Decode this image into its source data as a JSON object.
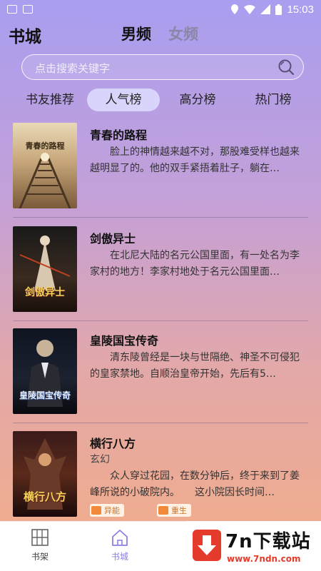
{
  "status_bar": {
    "time": "15:03"
  },
  "header": {
    "title": "书城",
    "tab_male": "男频",
    "tab_female": "女频"
  },
  "search": {
    "placeholder": "点击搜索关键字"
  },
  "rank_tabs": [
    "书友推荐",
    "人气榜",
    "高分榜",
    "热门榜"
  ],
  "books": [
    {
      "title": "青春的路程",
      "description": "脸上的神情越来越不对，那股难受样也越来越明显了的。他的双手紧捂着肚子，躺在…",
      "cover_text": "青春的路程"
    },
    {
      "title": "剑傲异士",
      "description": "在北尼大陆的名元公国里面，有一处名为李家村的地方！李家村地处于名元公国里面…",
      "cover_text": "剑傲异士"
    },
    {
      "title": "皇陵国宝传奇",
      "description": "清东陵曾经是一块与世隔绝、神圣不可侵犯的皇家禁地。自顺治皇帝开始，先后有5…",
      "cover_text": "皇陵国宝传奇"
    },
    {
      "title": "横行八方",
      "genre": "玄幻",
      "description": "众人穿过花园，在数分钟后，终于来到了姜峰所说的小破院内。　　这小院因长时间…",
      "cover_text": "横行八方",
      "tags": [
        "异能",
        "重生"
      ]
    }
  ],
  "bottom_nav": {
    "shelf_label": "书架",
    "store_label": "书城"
  },
  "watermark": {
    "title": "7n下载站",
    "url": "www.7ndn.com"
  }
}
